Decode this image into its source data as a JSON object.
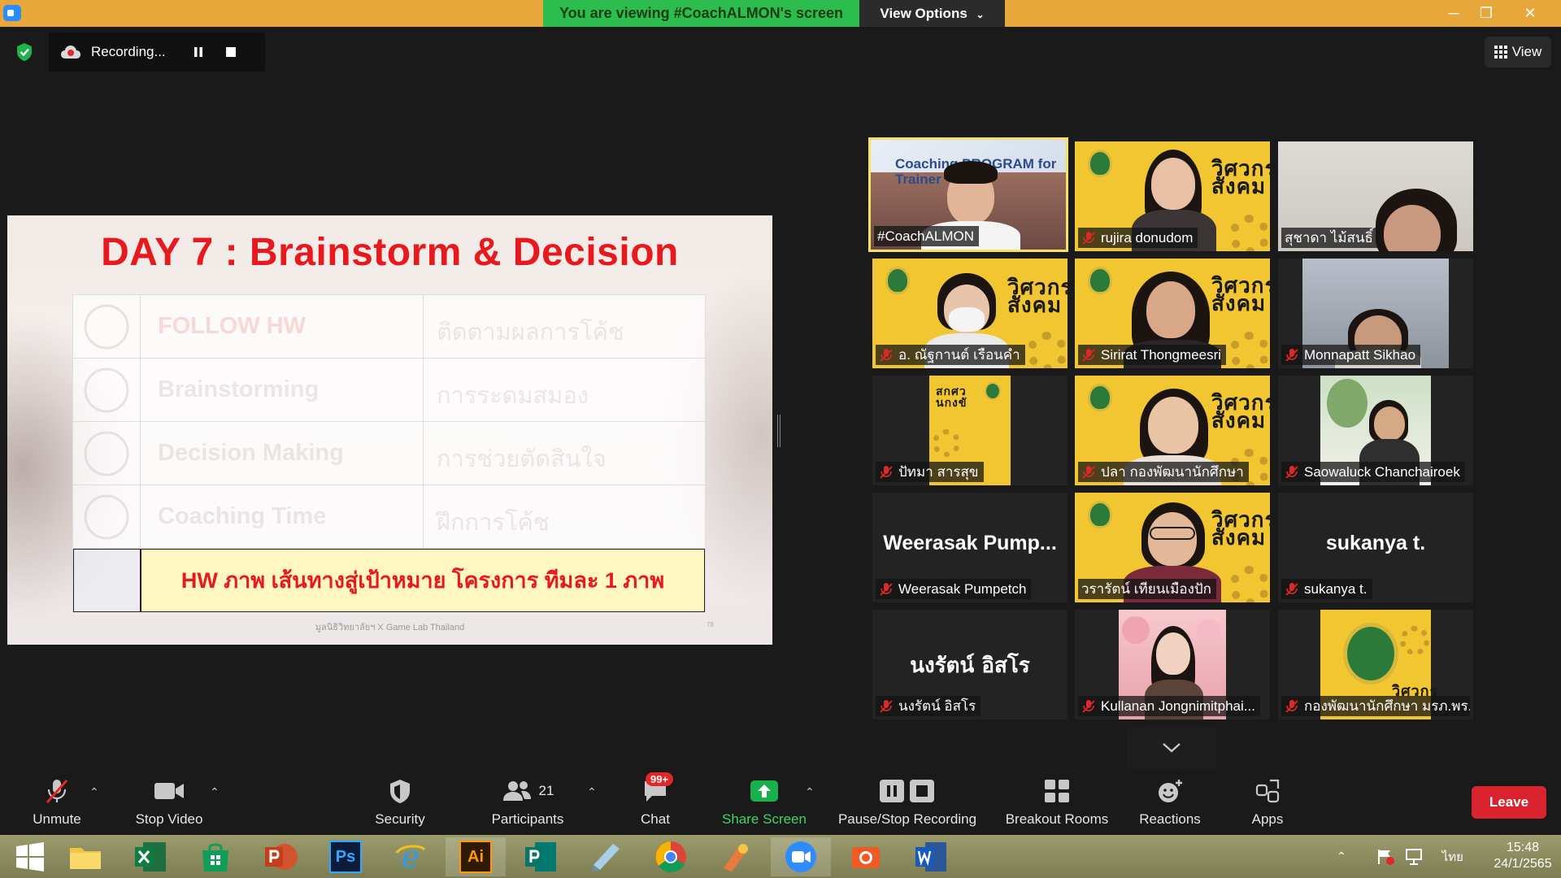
{
  "titlebar": {
    "share_banner": "You are viewing #CoachALMON's screen",
    "view_options": "View Options",
    "minimize": "─",
    "restore": "❐",
    "close": "✕"
  },
  "recording": {
    "status": "Recording...",
    "view_label": "View"
  },
  "slide": {
    "title": "DAY 7 : Brainstorm & Decision",
    "rows": [
      {
        "en": "FOLLOW HW",
        "th": "ติดตามผลการโค้ช"
      },
      {
        "en": "Brainstorming",
        "th": "การระดมสมอง"
      },
      {
        "en": "Decision Making",
        "th": "การช่วยตัดสินใจ"
      },
      {
        "en": "Coaching Time",
        "th": "ฝึกการโค้ช"
      }
    ],
    "homework": "HW ภาพ เส้นทางสู่เป้าหมาย โครงการ ทีมละ 1 ภาพ",
    "footer": "มูลนิธิวิทยาลัยฯ X Game Lab Thailand",
    "page_number": "78"
  },
  "participants": [
    {
      "name": "#CoachALMON",
      "muted": false
    },
    {
      "name": "rujira donudom",
      "muted": true
    },
    {
      "name": "สุชาดา ไม้สนธิ์",
      "muted": false
    },
    {
      "name": "อ. ณัฐกานต์ เรือนคำ",
      "muted": true
    },
    {
      "name": "Sirirat Thongmeesri",
      "muted": true
    },
    {
      "name": "Monnapatt Sikhao",
      "muted": true
    },
    {
      "name": "ปัทมา สารสุข",
      "muted": true
    },
    {
      "name": "ปลา กองพัฒนานักศึกษา",
      "muted": true
    },
    {
      "name": "Saowaluck Chanchairoek",
      "muted": true
    },
    {
      "name": "Weerasak Pumpetch",
      "muted": true,
      "display": "Weerasak  Pump..."
    },
    {
      "name": "วรารัตน์ เทียนเมืองปัก",
      "muted": false
    },
    {
      "name": "sukanya t.",
      "muted": true,
      "display": "sukanya t."
    },
    {
      "name": "นงรัตน์ อิสโร",
      "muted": true,
      "display": "นงรัตน์ อิสโร"
    },
    {
      "name": "Kullanan Jongnimitphai...",
      "muted": true
    },
    {
      "name": "กองพัฒนานักศึกษา มรภ.พร...",
      "muted": true
    }
  ],
  "poster": {
    "coaching_text": "Coaching PROGRAM for Trainer",
    "line1": "วิศวกร",
    "line2": "สังคม",
    "small_line1": "สกศว",
    "small_line2": "นกงขั"
  },
  "toolbar": {
    "unmute": "Unmute",
    "stop_video": "Stop Video",
    "security": "Security",
    "participants": "Participants",
    "participant_count": "21",
    "chat": "Chat",
    "chat_badge": "99+",
    "share_screen": "Share Screen",
    "pause_stop_recording": "Pause/Stop Recording",
    "breakout_rooms": "Breakout Rooms",
    "reactions": "Reactions",
    "apps": "Apps",
    "leave": "Leave"
  },
  "taskbar": {
    "language": "ไทย",
    "time": "15:48",
    "date": "24/1/2565",
    "apps": [
      "start-icon",
      "file-explorer-icon",
      "excel-icon",
      "store-icon",
      "powerpoint-icon",
      "photoshop-icon",
      "internet-explorer-icon",
      "illustrator-icon",
      "publisher-icon",
      "notes-icon",
      "chrome-icon",
      "paint-icon",
      "zoom-icon",
      "camera-icon",
      "word-icon"
    ],
    "labels": {
      "ps": "Ps",
      "ai": "Ai"
    }
  },
  "colors": {
    "banner_green": "#2dbc4e",
    "title_bar": "#e8a73a",
    "slide_red": "#e8191e",
    "active_speaker": "#f5e06b",
    "leave_red": "#d9232e",
    "share_green": "#19b14e"
  }
}
